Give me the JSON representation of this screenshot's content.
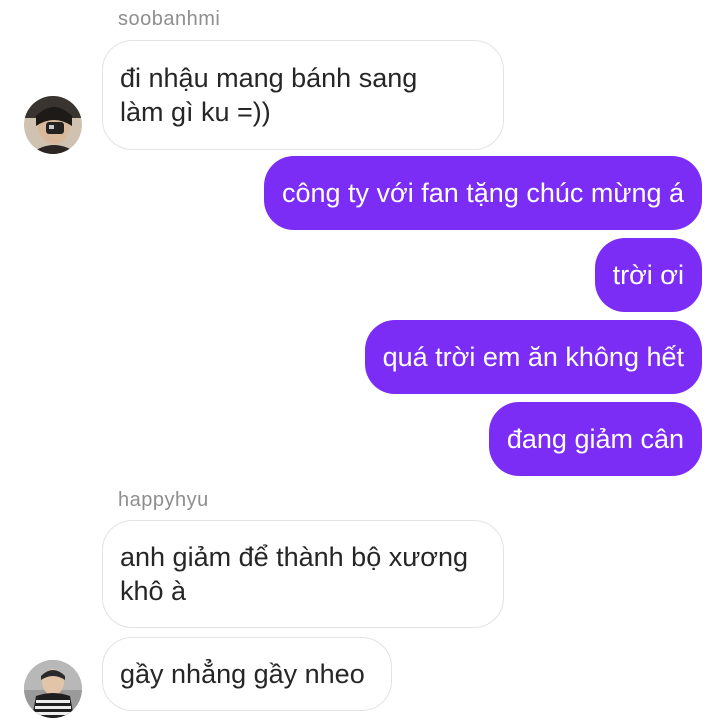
{
  "thread": {
    "groups": [
      {
        "sender": "soobanhmi",
        "messages": [
          "đi nhậu mang bánh sang\nlàm gì ku =))"
        ]
      },
      {
        "sender": "me",
        "messages": [
          "công ty với fan tặng chúc mừng á",
          "trời ơi",
          "quá trời em ăn không hết",
          "đang giảm cân"
        ]
      },
      {
        "sender": "happyhyu",
        "messages": [
          "anh giảm để thành bộ xương\nkhô à",
          "gầy nhẳng gầy nheo"
        ]
      }
    ]
  },
  "avatars": {
    "soobanhmi": "user-avatar-dark",
    "happyhyu": "user-avatar-striped"
  },
  "colors": {
    "outgoing_bubble": "#7b2cf5",
    "incoming_border": "#e3e3e3",
    "sender_name": "#8e8e8e"
  }
}
